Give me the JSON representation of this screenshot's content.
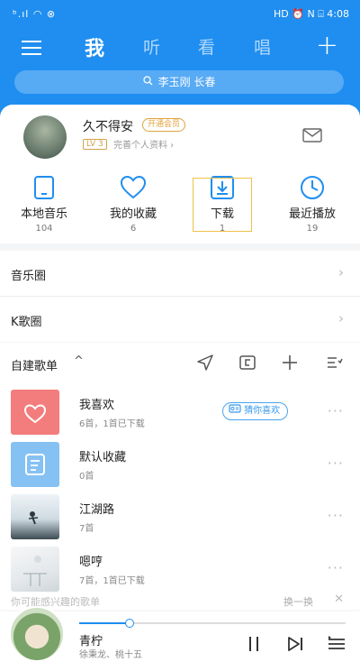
{
  "status_bar": {
    "left": "ᵇ.ıl ◠ ⊗",
    "right": "HD ⏰ N ⌸ 4:08"
  },
  "nav": {
    "tabs": [
      "我",
      "听",
      "看",
      "唱"
    ],
    "active_index": 0
  },
  "search": {
    "placeholder": "李玉刚 长春"
  },
  "profile": {
    "username": "久不得安",
    "vip_label": "开通会员",
    "level": "LV 3",
    "profile_link": "完善个人资料 ›"
  },
  "shortcuts": [
    {
      "label": "本地音乐",
      "count": "104",
      "icon": "tablet-icon"
    },
    {
      "label": "我的收藏",
      "count": "6",
      "icon": "heart-icon"
    },
    {
      "label": "下载",
      "count": "1",
      "icon": "download-icon"
    },
    {
      "label": "最近播放",
      "count": "19",
      "icon": "clock-icon"
    }
  ],
  "rows": [
    {
      "label": "音乐圈",
      "chevron": "›"
    },
    {
      "label": "K歌圈",
      "chevron": "›"
    }
  ],
  "playlists_header": {
    "title": "自建歌单",
    "caret": "^"
  },
  "playlists": [
    {
      "name": "我喜欢",
      "sub": "6首，1首已下载",
      "action_label": "猜你喜欢",
      "color": "#f37c7c"
    },
    {
      "name": "默认收藏",
      "sub": "0首",
      "color": "#86c1f4"
    },
    {
      "name": "江湖路",
      "sub": "7首"
    },
    {
      "name": "嗯哼",
      "sub": "7首，1首已下载"
    }
  ],
  "more_label": "···",
  "recommend": {
    "text": "你可能感兴趣的歌单",
    "swap_label": "换一换",
    "close_label": "✕"
  },
  "player": {
    "song": "青柠",
    "artist": "徐秉龙、桃十五",
    "progress": 0.19
  },
  "colors": {
    "brand": "#1f8ef0",
    "accent_yellow": "#f1c24a"
  }
}
